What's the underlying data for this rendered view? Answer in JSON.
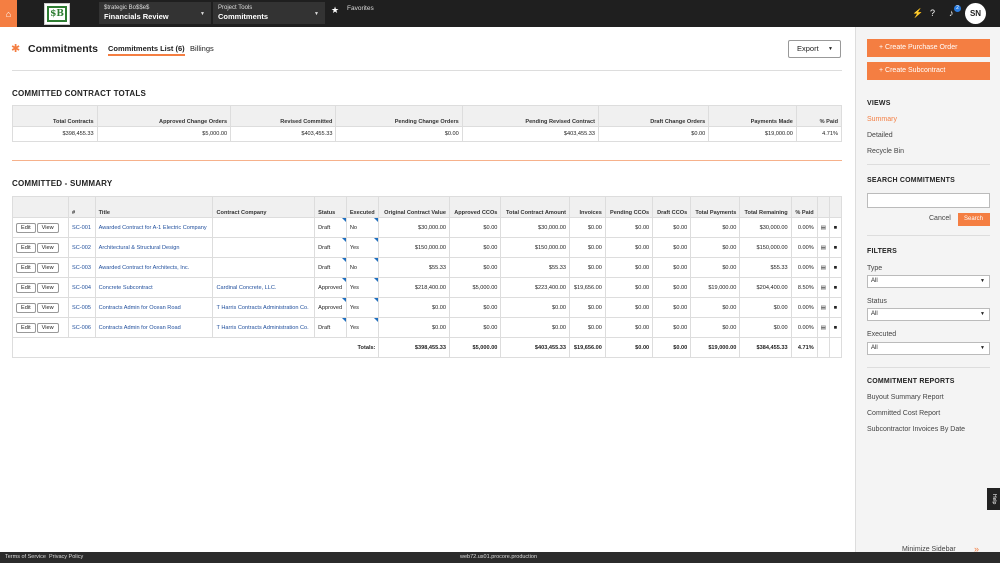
{
  "topbar": {
    "company_label": "$trategic Bo$$e$",
    "company_value": "Financials Review",
    "project_label": "Project Tools",
    "project_value": "Commitments",
    "favorites": "Favorites",
    "notif_count": "2",
    "avatar": "SN"
  },
  "page": {
    "title": "Commitments",
    "tab_list": "Commitments List (6)",
    "tab_billings": "Billings",
    "export": "Export"
  },
  "totals": {
    "heading": "COMMITTED CONTRACT TOTALS",
    "headers": [
      "Total Contracts",
      "Approved Change Orders",
      "Revised Committed",
      "Pending Change Orders",
      "Pending Revised Contract",
      "Draft Change Orders",
      "Payments Made",
      "% Paid"
    ],
    "values": [
      "$398,455.33",
      "$5,000.00",
      "$403,455.33",
      "$0.00",
      "$403,455.33",
      "$0.00",
      "$19,000.00",
      "4.71%"
    ]
  },
  "summary": {
    "heading": "COMMITTED - SUMMARY",
    "headers": [
      "#",
      "Title",
      "Contract Company",
      "Status",
      "Executed",
      "Original Contract Value",
      "Approved CCOs",
      "Total Contract Amount",
      "Invoices",
      "Pending CCOs",
      "Draft CCOs",
      "Total Payments",
      "Total Remaining",
      "% Paid"
    ],
    "edit": "Edit",
    "view": "View",
    "rows": [
      [
        "SC-001",
        "Awarded Contract for A-1 Electric Company",
        "",
        "Draft",
        "No",
        "$30,000.00",
        "$0.00",
        "$30,000.00",
        "$0.00",
        "$0.00",
        "$0.00",
        "$0.00",
        "$30,000.00",
        "0.00%"
      ],
      [
        "SC-002",
        "Architectural & Structural Design",
        "",
        "Draft",
        "Yes",
        "$150,000.00",
        "$0.00",
        "$150,000.00",
        "$0.00",
        "$0.00",
        "$0.00",
        "$0.00",
        "$150,000.00",
        "0.00%"
      ],
      [
        "SC-003",
        "Awarded Contract for Architects, Inc.",
        "",
        "Draft",
        "No",
        "$55.33",
        "$0.00",
        "$55.33",
        "$0.00",
        "$0.00",
        "$0.00",
        "$0.00",
        "$55.33",
        "0.00%"
      ],
      [
        "SC-004",
        "Concrete Subcontract",
        "Cardinal Concrete, LLC.",
        "Approved",
        "Yes",
        "$218,400.00",
        "$5,000.00",
        "$223,400.00",
        "$19,656.00",
        "$0.00",
        "$0.00",
        "$19,000.00",
        "$204,400.00",
        "8.50%"
      ],
      [
        "SC-005",
        "Contracts Admin for Ocean Road",
        "T Harris Contracts Administration Co.",
        "Approved",
        "Yes",
        "$0.00",
        "$0.00",
        "$0.00",
        "$0.00",
        "$0.00",
        "$0.00",
        "$0.00",
        "$0.00",
        "0.00%"
      ],
      [
        "SC-006",
        "Contracts Admin for Ocean Road",
        "T Harris Contracts Administration Co.",
        "Draft",
        "Yes",
        "$0.00",
        "$0.00",
        "$0.00",
        "$0.00",
        "$0.00",
        "$0.00",
        "$0.00",
        "$0.00",
        "0.00%"
      ]
    ],
    "totals_label": "Totals:",
    "totals": [
      "$398,455.33",
      "$5,000.00",
      "$403,455.33",
      "$19,656.00",
      "$0.00",
      "$0.00",
      "$19,000.00",
      "$384,455.33",
      "4.71%"
    ]
  },
  "sidebar": {
    "create_po": "Create Purchase Order",
    "create_sub": "Create Subcontract",
    "views": "VIEWS",
    "view_items": [
      "Summary",
      "Detailed",
      "Recycle Bin"
    ],
    "search_heading": "SEARCH COMMITMENTS",
    "cancel": "Cancel",
    "search": "Search",
    "filters": "FILTERS",
    "type": "Type",
    "type_val": "All",
    "status": "Status",
    "status_val": "All",
    "executed": "Executed",
    "executed_val": "All",
    "reports": "COMMITMENT REPORTS",
    "report_items": [
      "Buyout Summary Report",
      "Committed Cost Report",
      "Subcontractor Invoices By Date"
    ],
    "minimize": "Minimize Sidebar",
    "help": "Help"
  },
  "footer": {
    "terms": "Terms of Service",
    "privacy": "Privacy Policy",
    "server": "web72.us01.procore.production"
  },
  "colors": {
    "accent": "#f47e42",
    "link": "#1f4e9c"
  }
}
